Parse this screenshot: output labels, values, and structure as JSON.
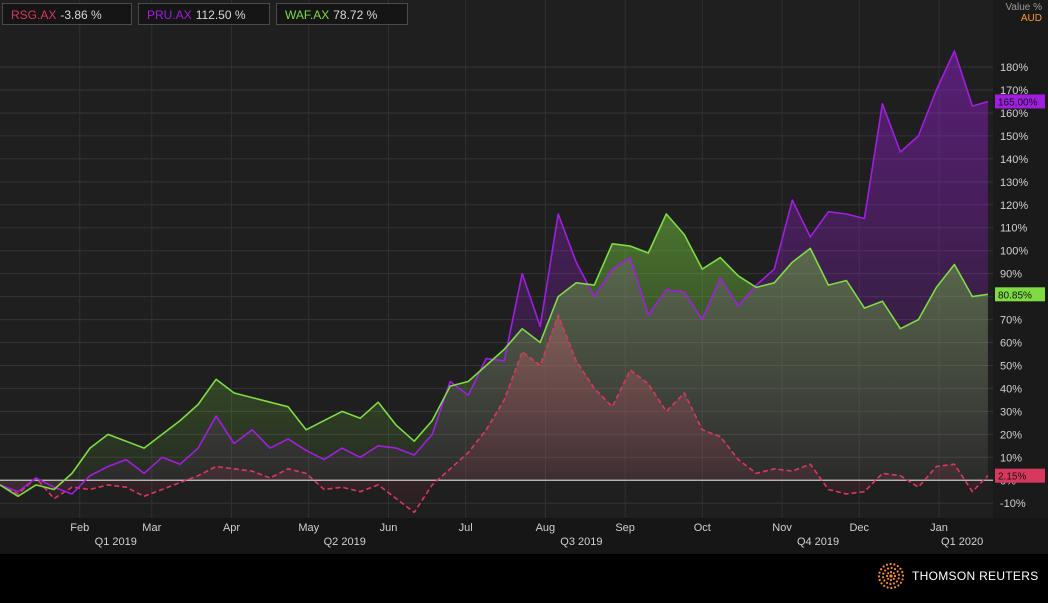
{
  "colors": {
    "background": "#1f1f1f",
    "rsg": "#d9385e",
    "pru": "#a01ee0",
    "waf": "#7edc42",
    "axis_text": "#d0d0d0",
    "zero_line": "#c8c8c8",
    "currency": "#ff9933"
  },
  "legend": [
    {
      "ticker": "RSG.AX",
      "value": "-3.86 %",
      "color": "#d9385e"
    },
    {
      "ticker": "PRU.AX",
      "value": "112.50 %",
      "color": "#a01ee0"
    },
    {
      "ticker": "WAF.AX",
      "value": "78.72 %",
      "color": "#7edc42"
    }
  ],
  "axis_header": {
    "value_label": "Value %",
    "currency": "AUD"
  },
  "logo": {
    "name": "THOMSON REUTERS",
    "icon": "thomson-reuters-sunburst-icon"
  },
  "chart_data": {
    "type": "line",
    "x_unit": "month",
    "xlim": [
      "2019-01-01",
      "2020-01-22"
    ],
    "month_ticks": [
      {
        "label": "Feb",
        "date": "2019-02-01"
      },
      {
        "label": "Mar",
        "date": "2019-03-01"
      },
      {
        "label": "Apr",
        "date": "2019-04-01"
      },
      {
        "label": "May",
        "date": "2019-05-01"
      },
      {
        "label": "Jun",
        "date": "2019-06-01"
      },
      {
        "label": "Jul",
        "date": "2019-07-01"
      },
      {
        "label": "Aug",
        "date": "2019-08-01"
      },
      {
        "label": "Sep",
        "date": "2019-09-01"
      },
      {
        "label": "Oct",
        "date": "2019-10-01"
      },
      {
        "label": "Nov",
        "date": "2019-11-01"
      },
      {
        "label": "Dec",
        "date": "2019-12-01"
      },
      {
        "label": "Jan",
        "date": "2020-01-01"
      }
    ],
    "quarter_labels": [
      {
        "label": "Q1 2019",
        "date": "2019-02-15"
      },
      {
        "label": "Q2 2019",
        "date": "2019-05-15"
      },
      {
        "label": "Q3 2019",
        "date": "2019-08-15"
      },
      {
        "label": "Q4 2019",
        "date": "2019-11-15"
      },
      {
        "label": "Q1 2020",
        "date": "2020-01-10"
      }
    ],
    "y_ticks": [
      -10,
      0,
      10,
      20,
      30,
      40,
      50,
      60,
      70,
      80,
      90,
      100,
      110,
      120,
      130,
      140,
      150,
      160,
      170,
      180
    ],
    "ylim": [
      -16,
      197
    ],
    "y_unit": "%",
    "grid": true,
    "legend_position": "top-left",
    "series": [
      {
        "name": "RSG.AX",
        "color": "#d9385e",
        "style": "dashed",
        "end_label": "2.15%",
        "x": [
          "2019-01-01",
          "2019-01-08",
          "2019-01-15",
          "2019-01-22",
          "2019-01-29",
          "2019-02-05",
          "2019-02-12",
          "2019-02-19",
          "2019-02-26",
          "2019-03-05",
          "2019-03-12",
          "2019-03-19",
          "2019-03-26",
          "2019-04-02",
          "2019-04-09",
          "2019-04-16",
          "2019-04-23",
          "2019-04-30",
          "2019-05-07",
          "2019-05-14",
          "2019-05-21",
          "2019-05-28",
          "2019-06-04",
          "2019-06-11",
          "2019-06-18",
          "2019-06-25",
          "2019-07-02",
          "2019-07-09",
          "2019-07-16",
          "2019-07-23",
          "2019-07-30",
          "2019-08-06",
          "2019-08-13",
          "2019-08-20",
          "2019-08-27",
          "2019-09-03",
          "2019-09-10",
          "2019-09-17",
          "2019-09-24",
          "2019-10-01",
          "2019-10-08",
          "2019-10-15",
          "2019-10-22",
          "2019-10-29",
          "2019-11-05",
          "2019-11-12",
          "2019-11-19",
          "2019-11-26",
          "2019-12-03",
          "2019-12-10",
          "2019-12-17",
          "2019-12-24",
          "2019-12-31",
          "2020-01-07",
          "2020-01-14",
          "2020-01-20"
        ],
        "values": [
          -2,
          -6,
          1,
          -8,
          -3,
          -4,
          -2,
          -3,
          -7,
          -4,
          -1,
          2,
          6,
          5,
          4,
          1,
          5,
          3,
          -4,
          -3,
          -5,
          -2,
          -8,
          -14,
          -2,
          5,
          12,
          22,
          35,
          56,
          50,
          72,
          52,
          40,
          32,
          48,
          42,
          30,
          38,
          22,
          19,
          9,
          3,
          5,
          4,
          7,
          -4,
          -6,
          -5,
          3,
          2,
          -3,
          6,
          7,
          -5,
          2
        ]
      },
      {
        "name": "PRU.AX",
        "color": "#a01ee0",
        "style": "solid",
        "end_label": "165.00%",
        "x": [
          "2019-01-01",
          "2019-01-08",
          "2019-01-15",
          "2019-01-22",
          "2019-01-29",
          "2019-02-05",
          "2019-02-12",
          "2019-02-19",
          "2019-02-26",
          "2019-03-05",
          "2019-03-12",
          "2019-03-19",
          "2019-03-26",
          "2019-04-02",
          "2019-04-09",
          "2019-04-16",
          "2019-04-23",
          "2019-04-30",
          "2019-05-07",
          "2019-05-14",
          "2019-05-21",
          "2019-05-28",
          "2019-06-04",
          "2019-06-11",
          "2019-06-18",
          "2019-06-25",
          "2019-07-02",
          "2019-07-09",
          "2019-07-16",
          "2019-07-23",
          "2019-07-30",
          "2019-08-06",
          "2019-08-13",
          "2019-08-20",
          "2019-08-27",
          "2019-09-03",
          "2019-09-10",
          "2019-09-17",
          "2019-09-24",
          "2019-10-01",
          "2019-10-08",
          "2019-10-15",
          "2019-10-22",
          "2019-10-29",
          "2019-11-05",
          "2019-11-12",
          "2019-11-19",
          "2019-11-26",
          "2019-12-03",
          "2019-12-10",
          "2019-12-17",
          "2019-12-24",
          "2019-12-31",
          "2020-01-07",
          "2020-01-14",
          "2020-01-20"
        ],
        "values": [
          -2,
          -5,
          1,
          -3,
          -6,
          2,
          6,
          9,
          3,
          10,
          7,
          14,
          28,
          16,
          22,
          14,
          18,
          13,
          9,
          14,
          10,
          15,
          14,
          11,
          20,
          43,
          37,
          53,
          52,
          90,
          67,
          116,
          95,
          80,
          92,
          97,
          72,
          83,
          82,
          70,
          88,
          76,
          85,
          92,
          122,
          106,
          117,
          116,
          114,
          164,
          143,
          150,
          170,
          187,
          163,
          165
        ]
      },
      {
        "name": "WAF.AX",
        "color": "#7edc42",
        "style": "solid",
        "end_label": "80.85%",
        "x": [
          "2019-01-01",
          "2019-01-08",
          "2019-01-15",
          "2019-01-22",
          "2019-01-29",
          "2019-02-05",
          "2019-02-12",
          "2019-02-19",
          "2019-02-26",
          "2019-03-05",
          "2019-03-12",
          "2019-03-19",
          "2019-03-26",
          "2019-04-02",
          "2019-04-09",
          "2019-04-16",
          "2019-04-23",
          "2019-04-30",
          "2019-05-07",
          "2019-05-14",
          "2019-05-21",
          "2019-05-28",
          "2019-06-04",
          "2019-06-11",
          "2019-06-18",
          "2019-06-25",
          "2019-07-02",
          "2019-07-09",
          "2019-07-16",
          "2019-07-23",
          "2019-07-30",
          "2019-08-06",
          "2019-08-13",
          "2019-08-20",
          "2019-08-27",
          "2019-09-03",
          "2019-09-10",
          "2019-09-17",
          "2019-09-24",
          "2019-10-01",
          "2019-10-08",
          "2019-10-15",
          "2019-10-22",
          "2019-10-29",
          "2019-11-05",
          "2019-11-12",
          "2019-11-19",
          "2019-11-26",
          "2019-12-03",
          "2019-12-10",
          "2019-12-17",
          "2019-12-24",
          "2019-12-31",
          "2020-01-07",
          "2020-01-14",
          "2020-01-20"
        ],
        "values": [
          -2,
          -7,
          -2,
          -4,
          3,
          14,
          20,
          17,
          14,
          20,
          26,
          33,
          44,
          38,
          36,
          34,
          32,
          22,
          26,
          30,
          27,
          34,
          24,
          17,
          26,
          41,
          43,
          50,
          57,
          66,
          60,
          80,
          86,
          85,
          103,
          102,
          99,
          116,
          107,
          92,
          97,
          89,
          84,
          86,
          95,
          101,
          85,
          87,
          75,
          78,
          66,
          70,
          84,
          94,
          80,
          81
        ]
      }
    ]
  }
}
